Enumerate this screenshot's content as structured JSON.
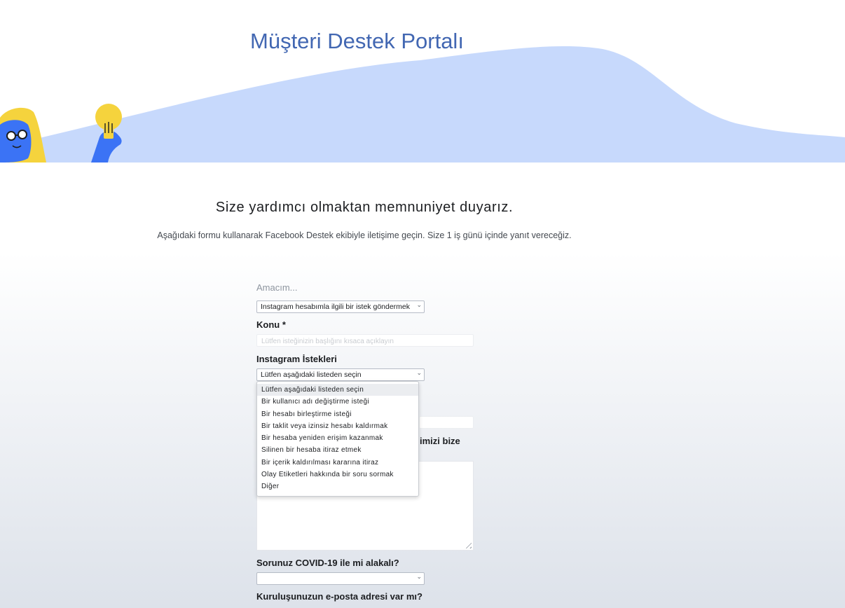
{
  "header": {
    "title": "Müşteri Destek Portalı"
  },
  "intro": {
    "headline": "Size yardımcı olmaktan memnuniyet duyarız.",
    "subtext": "Aşağıdaki formu kullanarak Facebook Destek ekibiyle iletişime geçin. Size 1 iş günü içinde yanıt vereceğiz."
  },
  "form": {
    "purpose_label": "Amacım...",
    "purpose_value": "Instagram hesabımla ilgili bir istek göndermek",
    "subject_label": "Konu *",
    "subject_placeholder": "Lütfen isteğinizin başlığını kısaca açıklayın",
    "instagram_label": "Instagram İstekleri",
    "instagram_value": "Lütfen aşağıdaki listeden seçin",
    "instagram_options": [
      "Lütfen aşağıdaki listeden seçin",
      "Bir kullanıcı adı değiştirme isteği",
      "Bir hesabı birleştirme isteği",
      "Bir taklit veya izinsiz hesabı kaldırmak",
      "Bir hesaba yeniden erişim kazanmak",
      "Silinen bir hesaba itiraz etmek",
      "Bir içerik kaldırılması kararına itiraz",
      "Olay Etiketleri hakkında bir soru sormak",
      "Diğer"
    ],
    "partially_hidden_label": "imizi bize",
    "covid_label": "Sorunuz COVID-19 ile mi alakalı?",
    "covid_value": "",
    "org_email_label": "Kuruluşunuzun e-posta adresi var mı?"
  },
  "colors": {
    "brand_blue": "#4267b2",
    "wave": "#c7d9fc",
    "illustration_blue": "#3b73f5",
    "illustration_yellow": "#f5d33d"
  }
}
